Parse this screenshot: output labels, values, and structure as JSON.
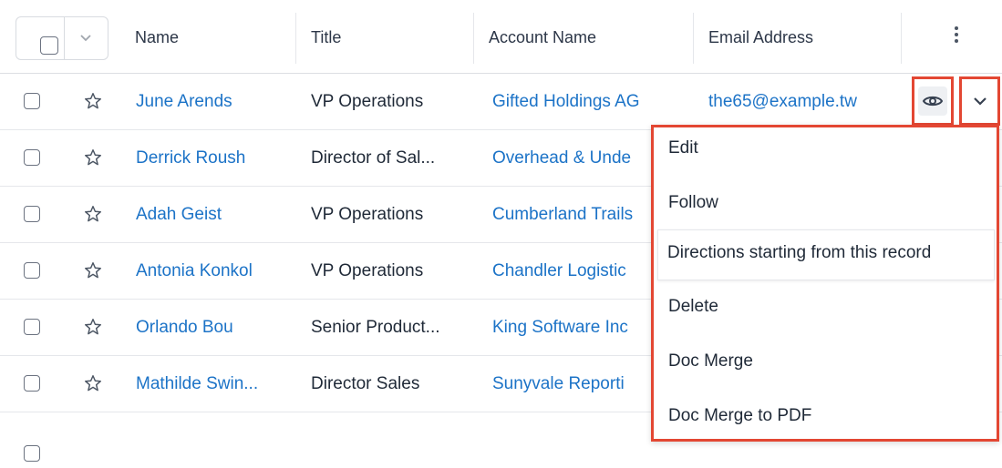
{
  "header": {
    "columns": [
      "Name",
      "Title",
      "Account Name",
      "Email Address"
    ]
  },
  "rows": [
    {
      "name": "June Arends",
      "title": "VP Operations",
      "account": "Gifted Holdings AG",
      "email": "the65@example.tw"
    },
    {
      "name": "Derrick Roush",
      "title": "Director of Sal...",
      "account": "Overhead & Unde",
      "email": ""
    },
    {
      "name": "Adah Geist",
      "title": "VP Operations",
      "account": "Cumberland Trails",
      "email": ""
    },
    {
      "name": "Antonia Konkol",
      "title": "VP Operations",
      "account": "Chandler Logistic",
      "email": ""
    },
    {
      "name": "Orlando Bou",
      "title": "Senior Product...",
      "account": "King Software Inc",
      "email": ""
    },
    {
      "name": "Mathilde Swin...",
      "title": "Director Sales",
      "account": "Sunyvale Reporti",
      "email": ""
    }
  ],
  "menu": {
    "items": [
      "Edit",
      "Follow",
      "Directions starting from this record",
      "Delete",
      "Doc Merge",
      "Doc Merge to PDF"
    ]
  },
  "colors": {
    "link": "#1c73c7",
    "highlight_border": "#e34733"
  }
}
